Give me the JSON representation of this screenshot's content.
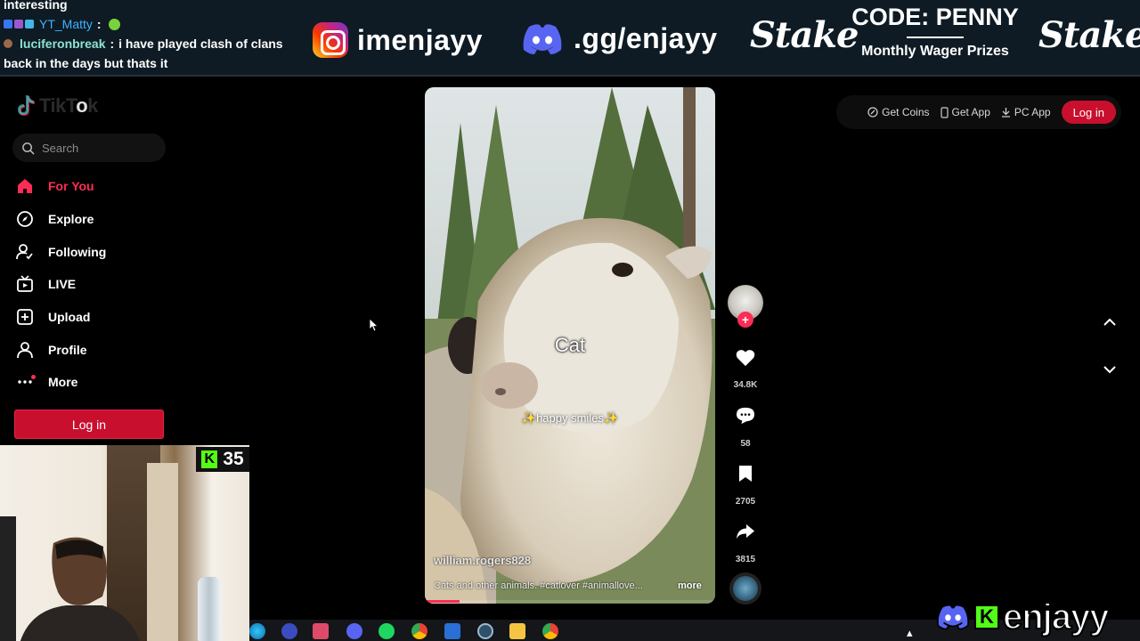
{
  "overlay": {
    "chat": {
      "line0": "interesting",
      "msg1": {
        "user": "YT_Matty",
        "colon": ":"
      },
      "msg2": {
        "user": "luciferonbreak",
        "colon": ":",
        "text": "i have played clash of clans",
        "cont": "back in the days but thats it"
      }
    },
    "instagram": {
      "icon": "instagram-icon",
      "handle": "imenjayy"
    },
    "discord": {
      "icon": "discord-icon",
      "invite": ".gg/enjayy"
    },
    "stake_left": "Stake",
    "stake_right": "Stake",
    "promo": {
      "code": "CODE: PENNY",
      "subtitle": "Monthly Wager Prizes"
    },
    "kick": {
      "icon": "kick-icon",
      "letter": "K",
      "viewers": "35"
    },
    "brand": {
      "letter": "K",
      "name": "enjayy"
    }
  },
  "tiktok": {
    "logo_text_before": "TikT",
    "logo_text_o": "o",
    "logo_text_after": "k",
    "search": {
      "placeholder": "Search"
    },
    "nav": [
      {
        "label": "For You",
        "icon": "home-icon",
        "active": true
      },
      {
        "label": "Explore",
        "icon": "compass-icon"
      },
      {
        "label": "Following",
        "icon": "following-icon"
      },
      {
        "label": "LIVE",
        "icon": "live-icon"
      },
      {
        "label": "Upload",
        "icon": "upload-icon"
      },
      {
        "label": "Profile",
        "icon": "profile-icon"
      },
      {
        "label": "More",
        "icon": "more-icon"
      }
    ],
    "login_label": "Log in",
    "topbar": {
      "get_coins": "Get Coins",
      "get_app": "Get App",
      "pc_app": "PC App",
      "login": "Log in"
    },
    "video": {
      "caption_main": "Cat",
      "caption_sub_left": "✨",
      "caption_sub": "happy smiles",
      "caption_sub_right": "✨",
      "author": "william.rogers828",
      "description": "Cats and other animals. #catlover #animallove...",
      "more": "more",
      "progress": 0.12
    },
    "actions": {
      "likes": "34.8K",
      "comments": "58",
      "saves": "2705",
      "shares": "3815"
    }
  },
  "colors": {
    "accent": "#fe2c55",
    "login_bg": "#c8102e",
    "banner_bg": "#0e1b24",
    "kick_green": "#53fc18"
  }
}
